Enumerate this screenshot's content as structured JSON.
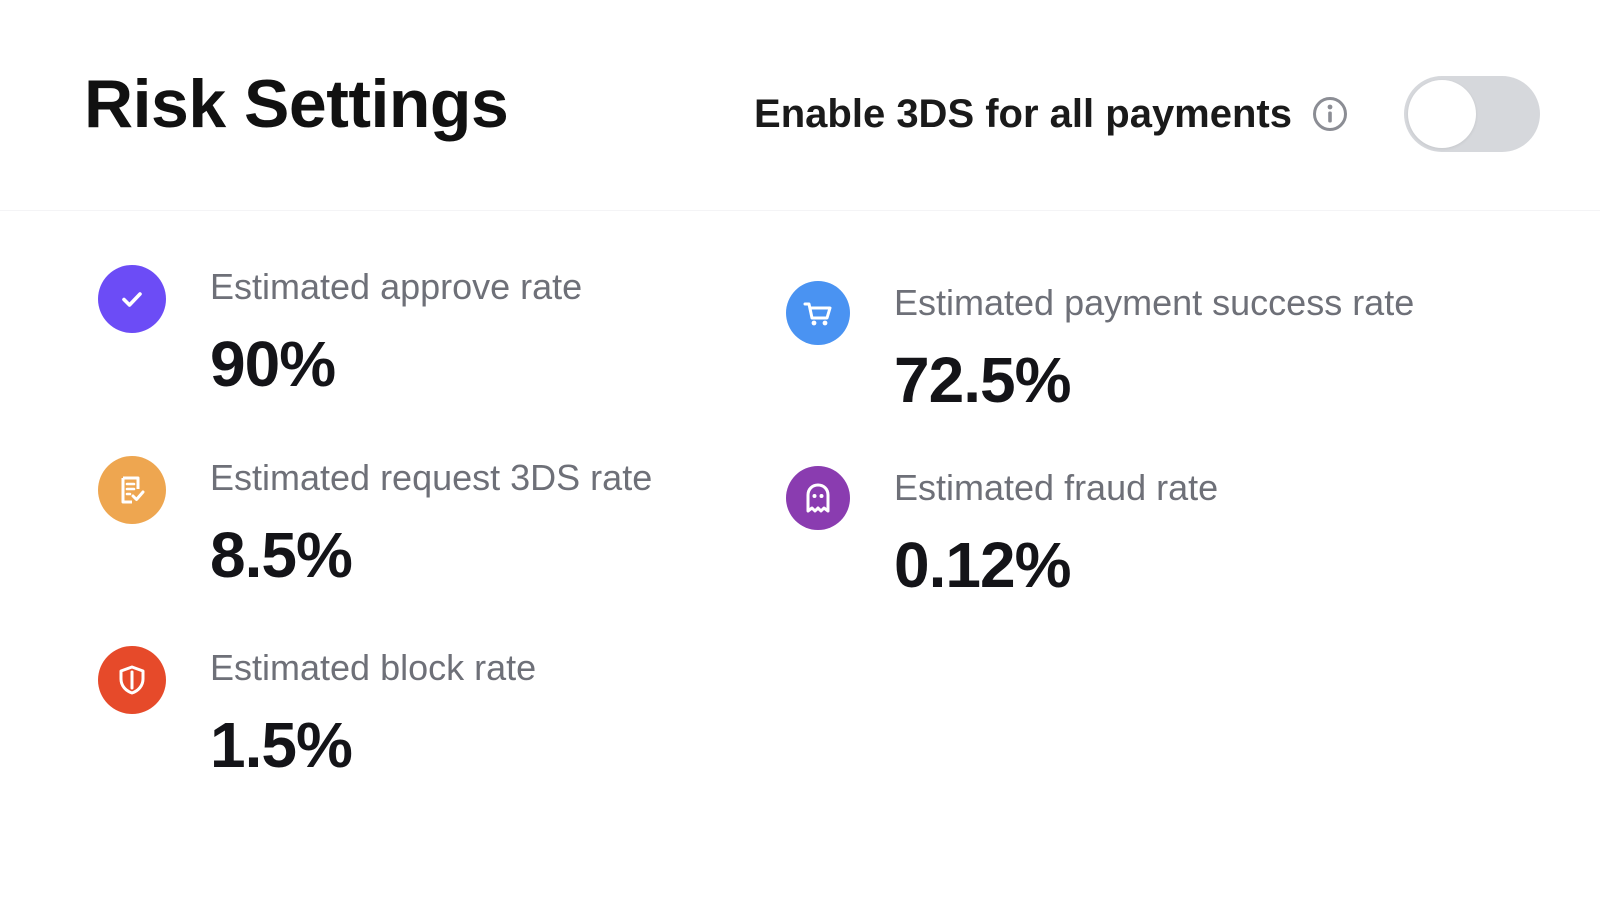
{
  "header": {
    "title": "Risk Settings",
    "toggle_label": "Enable 3DS for all payments",
    "toggle_enabled": false
  },
  "metrics": [
    {
      "label": "Estimated approve rate",
      "value": "90%",
      "icon": "check-icon",
      "color": "#6c4cf6"
    },
    {
      "label": "Estimated request 3DS rate",
      "value": "8.5%",
      "icon": "document-check-icon",
      "color": "#eea650"
    },
    {
      "label": "Estimated block rate",
      "value": "1.5%",
      "icon": "shield-icon",
      "color": "#e64a2a"
    },
    {
      "label": "Estimated payment success rate",
      "value": "72.5%",
      "icon": "cart-icon",
      "color": "#4a93f2"
    },
    {
      "label": "Estimated fraud rate",
      "value": "0.12%",
      "icon": "ghost-icon",
      "color": "#8a3cb0"
    }
  ],
  "colors": {
    "toggle_off": "#d6d8dc",
    "label_text": "#6e7078",
    "value_text": "#141418"
  }
}
